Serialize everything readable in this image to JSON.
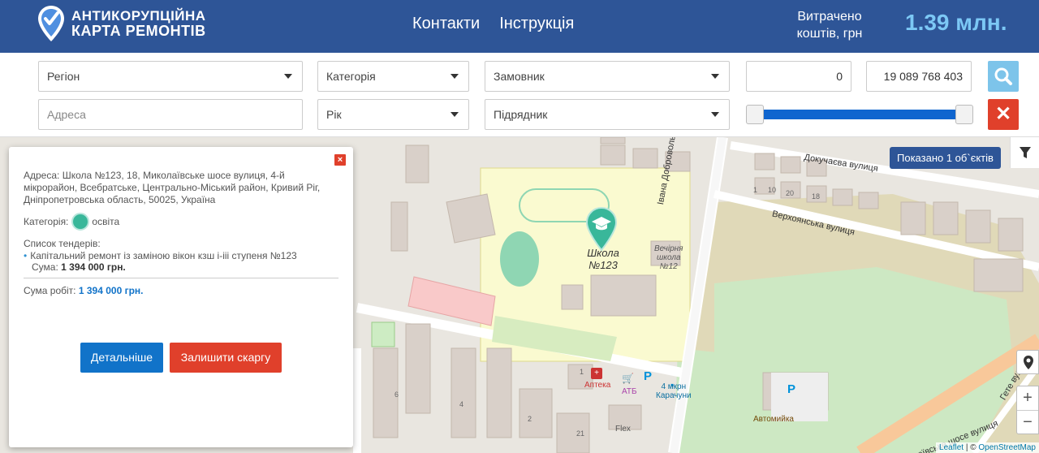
{
  "header": {
    "logo_line1": "АНТИКОРУПЦІЙНА",
    "logo_line2": "КАРТА РЕМОНТІВ",
    "nav": [
      "Контакти",
      "Інструкція"
    ],
    "spent_label_1": "Витрачено",
    "spent_label_2": "коштів, грн",
    "spent_value": "1.39 млн."
  },
  "filters": {
    "region": "Регіон",
    "category": "Категорія",
    "customer": "Замовник",
    "min_value": "0",
    "max_value": "19 089 768 403",
    "address_placeholder": "Адреса",
    "year": "Рік",
    "contractor": "Підрядник",
    "slider_low": 0,
    "slider_high": 1
  },
  "map": {
    "shown_badge": "Показано 1 об`єктів",
    "marker_label_1": "Школа",
    "marker_label_2": "№123",
    "labels": {
      "dokuchaeva": "Докучаєва вулиця",
      "verkhoyanska": "Верхоянська вулиця",
      "dobrovolskogo": "Івана Добровольського вулиця",
      "evening_school_1": "Вечірня",
      "evening_school_2": "школа",
      "evening_school_3": "№12",
      "pharmacy": "Аптека",
      "atb": "АТБ",
      "bus_stop_1": "4 мкрн",
      "bus_stop_2": "Карачуни",
      "car_wash": "Автомийка",
      "flex": "Flex",
      "mykolaivske": "Миколаївське шосе вулиця",
      "gete": "Гете вулиця",
      "house_1": "1",
      "house_10": "10",
      "house_20": "20",
      "house_18": "18",
      "house_6": "6",
      "house_4": "4",
      "house_2": "2",
      "house_21": "21",
      "house_1b": "1",
      "parking": "P"
    },
    "zoom_in": "+",
    "zoom_out": "−",
    "attribution_leaflet": "Leaflet",
    "attribution_sep": " | © ",
    "attribution_osm": "OpenStreetMap"
  },
  "popup": {
    "close": "×",
    "address": "Адреса: Школа №123, 18, Миколаївське шосе вулиця, 4-й мікрорайон, Всебратське, Центрально-Міський район, Кривий Ріг, Дніпропетровська область, 50025, Україна",
    "category_label": "Категорія:",
    "category_value": "освіта",
    "tenders_label": "Список тендерів:",
    "tender_name": "Капітальний ремонт із заміною вікон кзш і-ііі ступеня №123",
    "tender_sum_label": "Сума:",
    "tender_sum": "1 394 000 грн.",
    "total_label": "Сума робіт:",
    "total_value": "1 394 000 грн.",
    "details_button": "Детальніше",
    "complain_button": "Залишити скаргу"
  },
  "colors": {
    "header_bg": "#2e5597",
    "accent_value": "#7cc8f5",
    "danger": "#e0402b",
    "primary": "#1173c9",
    "marker": "#39b79a"
  }
}
